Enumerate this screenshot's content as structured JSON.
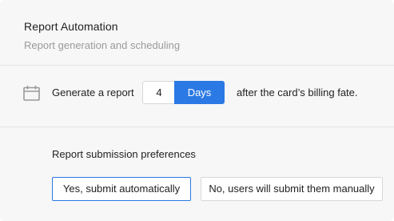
{
  "header": {
    "title": "Report Automation",
    "subtitle": "Report generation and scheduling"
  },
  "generate": {
    "icon": "calendar-icon",
    "label": "Generate a report",
    "count_value": "4",
    "unit_label": "Days",
    "suffix_text": "after the card’s billing fate."
  },
  "submission": {
    "label": "Report submission preferences",
    "options": [
      {
        "label": "Yes, submit automatically",
        "selected": true
      },
      {
        "label": "No, users will submit them manually",
        "selected": false
      }
    ]
  },
  "colors": {
    "accent": "#2b79e4",
    "background": "#f7f7f7",
    "muted_text": "#9a9a9a"
  }
}
